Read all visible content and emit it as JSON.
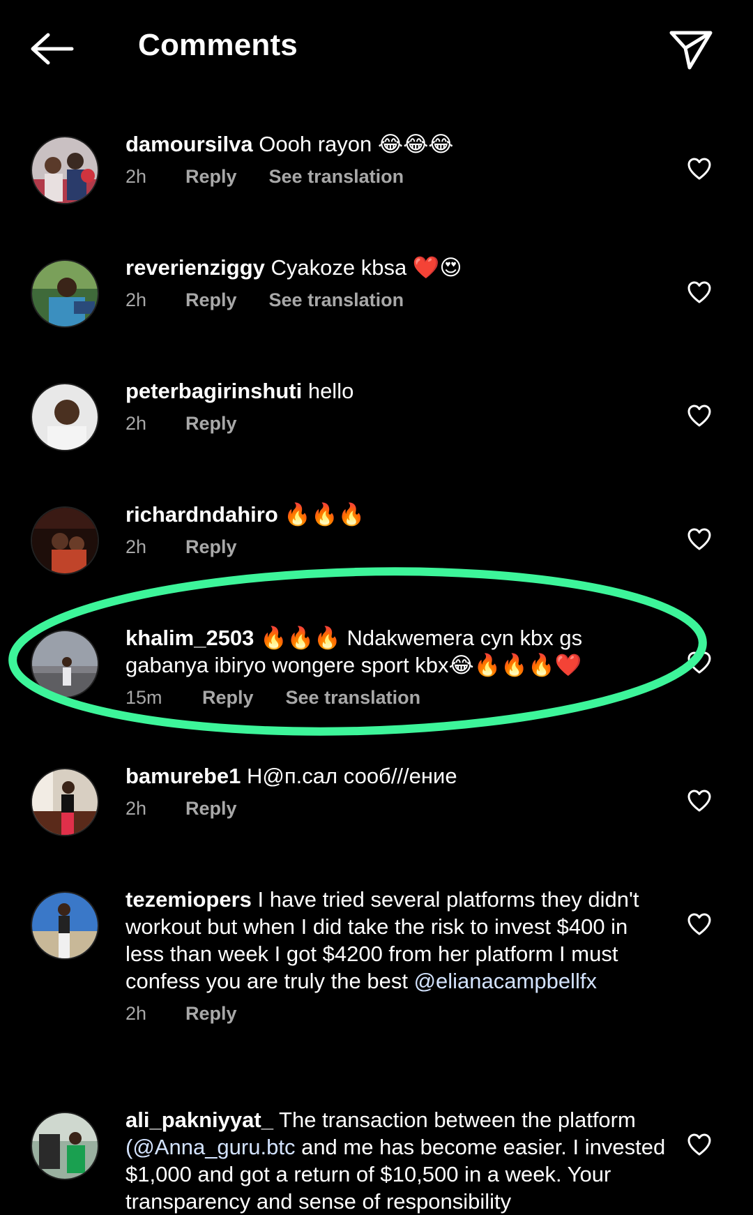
{
  "header": {
    "title": "Comments",
    "back_icon": "arrow-left-icon",
    "send_icon": "paper-plane-icon"
  },
  "colors": {
    "background": "#000000",
    "text": "#ffffff",
    "meta": "#a8a8a8",
    "highlight": "#3df59a"
  },
  "comments": [
    {
      "username": "damoursilva",
      "text": "Oooh rayon 😂😂😂",
      "time": "2h",
      "reply": "Reply",
      "translation": "See translation"
    },
    {
      "username": "reverienziggy",
      "text": "Cyakoze kbsa ❤️😍",
      "time": "2h",
      "reply": "Reply",
      "translation": "See translation"
    },
    {
      "username": "peterbagirinshuti",
      "text": "hello",
      "time": "2h",
      "reply": "Reply"
    },
    {
      "username": "richardndahiro",
      "text": "🔥🔥🔥",
      "time": "2h",
      "reply": "Reply"
    },
    {
      "username": "khalim_2503",
      "text": "🔥🔥🔥 Ndakwemera cyn kbx gs gabanya ibiryo wongere sport kbx😂🔥🔥🔥❤️",
      "time": "15m",
      "reply": "Reply",
      "translation": "See translation"
    },
    {
      "username": "bamurebe1",
      "text": "Н@п.сал сооб///ение",
      "time": "2h",
      "reply": "Reply"
    },
    {
      "username": "tezemiopers",
      "text": "I have tried several platforms they didn't workout but when I did take the risk to invest $400 in less than week I got $4200 from her platform I must confess you are truly the best",
      "mention": "@elianacampbellfx",
      "time": "2h",
      "reply": "Reply"
    },
    {
      "username": "ali_pakniyyat_",
      "text": "The transaction between the platform",
      "mention": "(@Anna_guru.btc",
      "text_after": "and me has become easier. I invested $1,000 and got a return of $10,500 in a week. Your transparency and sense of responsibility"
    }
  ]
}
